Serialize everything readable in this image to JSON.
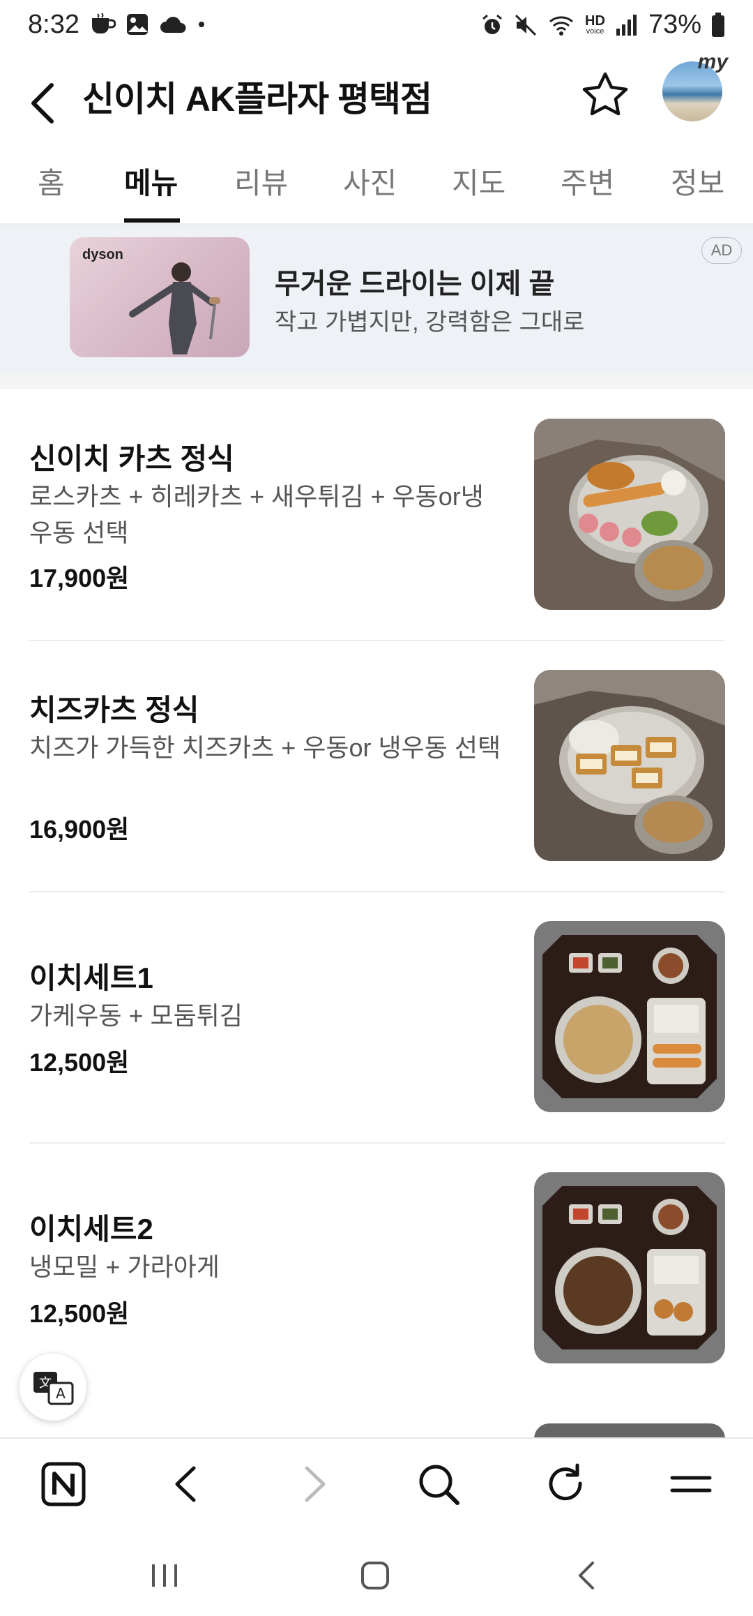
{
  "status_bar": {
    "time": "8:32",
    "battery": "73%",
    "hd_label": "HD",
    "voice_label": "voice"
  },
  "header": {
    "title": "신이치 AK플라자 평택점",
    "avatar_badge": "my"
  },
  "tabs": [
    {
      "label": "홈",
      "active": false
    },
    {
      "label": "메뉴",
      "active": true
    },
    {
      "label": "리뷰",
      "active": false
    },
    {
      "label": "사진",
      "active": false
    },
    {
      "label": "지도",
      "active": false
    },
    {
      "label": "주변",
      "active": false
    },
    {
      "label": "정보",
      "active": false
    }
  ],
  "ad": {
    "brand": "dyson",
    "title": "무거운 드라이는 이제 끝",
    "subtitle": "작고 가볍지만, 강력함은 그대로",
    "badge": "AD"
  },
  "menu": [
    {
      "name": "신이치 카츠 정식",
      "desc": "로스카츠 + 히레카츠 + 새우튀김 + 우동or냉우동 선택",
      "price": "17,900원"
    },
    {
      "name": "치즈카츠 정식",
      "desc": "치즈가 가득한 치즈카츠 + 우동or 냉우동 선택",
      "price": "16,900원"
    },
    {
      "name": "이치세트1",
      "desc": "가케우동 + 모둠튀김",
      "price": "12,500원"
    },
    {
      "name": "이치세트2",
      "desc": "냉모밀 + 가라아게",
      "price": "12,500원"
    }
  ],
  "colors": {
    "accent": "#111111",
    "ad_bg": "#eef1f6",
    "muted_text": "#555555"
  },
  "icons": {
    "back": "back-arrow-icon",
    "favorite": "star-icon",
    "translate": "translate-icon",
    "naver": "naver-icon",
    "prev": "chevron-left-icon",
    "next": "chevron-right-icon",
    "search": "search-icon",
    "refresh": "refresh-icon",
    "menu": "hamburger-icon"
  }
}
